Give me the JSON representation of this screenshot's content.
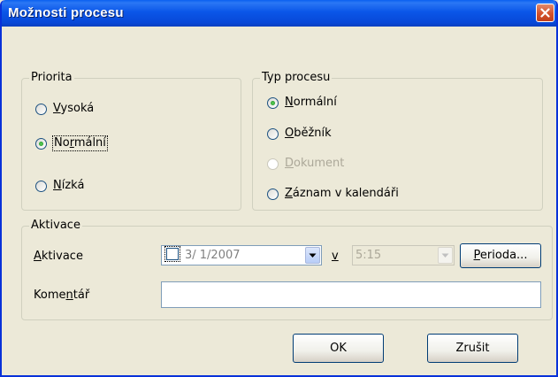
{
  "window": {
    "title": "Možnosti procesu"
  },
  "priority": {
    "legend": "Priorita",
    "options": [
      {
        "prefix": "",
        "accel": "V",
        "rest": "ysoká",
        "checked": false
      },
      {
        "prefix": "No",
        "accel": "r",
        "rest": "mální",
        "checked": true
      },
      {
        "prefix": "",
        "accel": "N",
        "rest": "ízká",
        "checked": false
      }
    ]
  },
  "process_type": {
    "legend": "Typ procesu",
    "options": [
      {
        "prefix": "",
        "accel": "N",
        "rest": "ormální",
        "checked": true,
        "disabled": false
      },
      {
        "prefix": "",
        "accel": "O",
        "rest": "běžník",
        "checked": false,
        "disabled": false
      },
      {
        "prefix": "",
        "accel": "D",
        "rest": "okument",
        "checked": false,
        "disabled": true
      },
      {
        "prefix": "",
        "accel": "Z",
        "rest": "áznam v kalendáři",
        "checked": false,
        "disabled": false
      }
    ]
  },
  "activation": {
    "legend": "Aktivace",
    "label_accel": "A",
    "label_rest": "ktivace",
    "date_value": "3/ 1/2007",
    "at_label": "v",
    "time_value": "5:15",
    "period_accel": "P",
    "period_rest": "erioda..."
  },
  "comment": {
    "label_prefix": "Kome",
    "label_accel": "n",
    "label_rest": "tář",
    "value": ""
  },
  "buttons": {
    "ok": "OK",
    "cancel": "Zrušit"
  },
  "colors": {
    "title_bar": "#0a56e8",
    "dialog_bg": "#ece9d8",
    "close_button": "#d4512b",
    "radio_dot": "#21a121"
  }
}
